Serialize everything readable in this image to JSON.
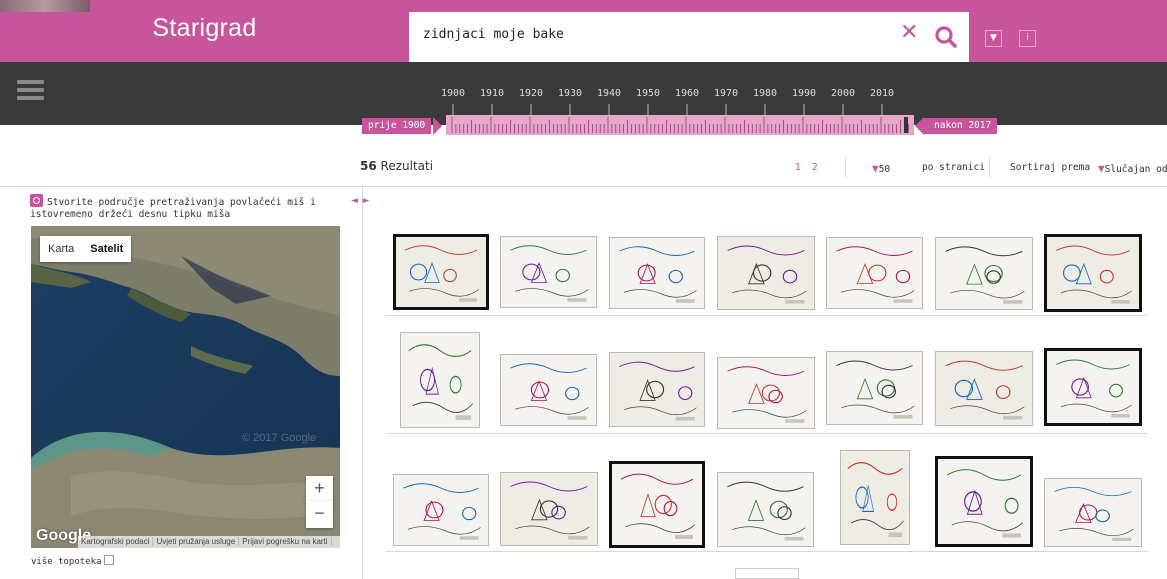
{
  "header": {
    "brand": "Starigrad",
    "search_value": "zidnjaci moje bake",
    "clear_icon": "close-icon",
    "search_icon": "search-icon",
    "btn_down": "▼",
    "btn_info": "i",
    "accent_color": "#c8559c"
  },
  "timeline": {
    "years": [
      "1900",
      "1910",
      "1920",
      "1930",
      "1940",
      "1950",
      "1960",
      "1970",
      "1980",
      "1990",
      "2000",
      "2010"
    ],
    "before_label": "prije 1900",
    "after_label": "nakon 2017"
  },
  "results": {
    "count": "56",
    "count_label": "Rezultati",
    "pages": [
      "1",
      "2"
    ],
    "per_page": "50",
    "per_page_label": "po stranici",
    "sort_label": "Sortiraj prema",
    "sort_value": "Slučajan odabir"
  },
  "map_panel": {
    "area_hint": "Stvorite područje pretraživanja povlačeći miš i istovremeno držeći desnu tipku miša",
    "collapse": "◄ ►",
    "map_type_map": "Karta",
    "map_type_satellite": "Satelit",
    "zoom_in": "+",
    "zoom_out": "−",
    "logo": "Google",
    "watermark": "© 2017 Google",
    "footer_links": [
      "Kartografski podaci",
      "Uvjeti pružanja usluge",
      "Prijavi pogrešku na karti"
    ],
    "more_layers": "više topoteka"
  }
}
